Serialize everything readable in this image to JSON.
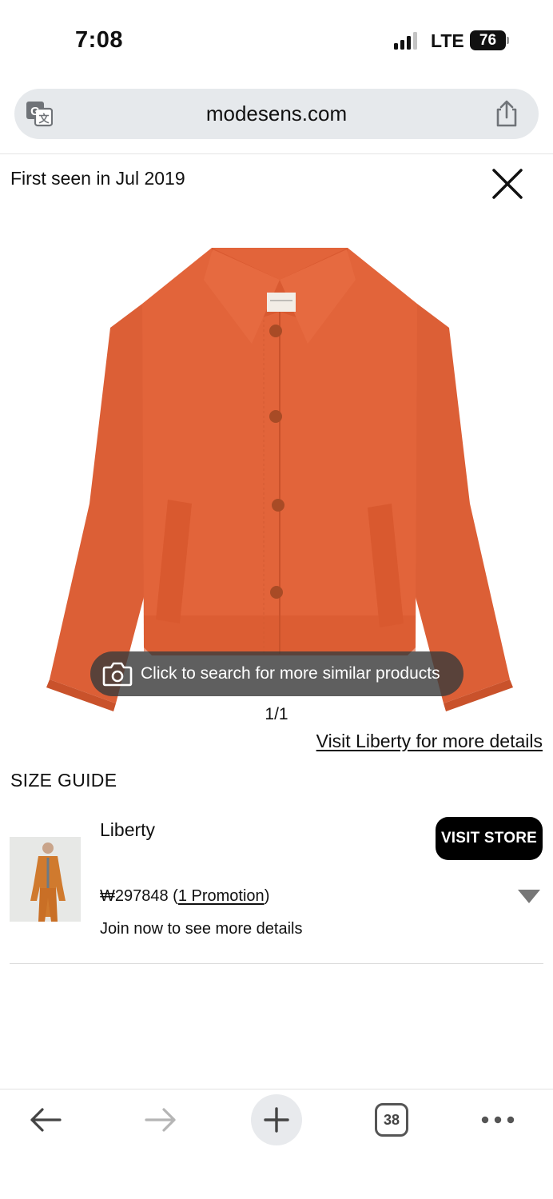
{
  "status_bar": {
    "time": "7:08",
    "network": "LTE",
    "battery": "76"
  },
  "browser": {
    "url": "modesens.com",
    "translate_icon": "translate-icon",
    "share_icon": "share-icon"
  },
  "product": {
    "first_seen": "First seen in Jul 2019",
    "image_icon": "orange-chore-jacket",
    "search_similar_label": "Click to search for more similar products",
    "pager": "1/1",
    "visit_link": "Visit Liberty for more details",
    "size_guide": "SIZE GUIDE"
  },
  "store": {
    "name": "Liberty",
    "visit_button": "VISIT STORE",
    "price": "₩297848",
    "promo_open": " (",
    "promo_link": "1 Promotion",
    "promo_close": ")",
    "join_text": "Join now to see more details"
  },
  "toolbar": {
    "tabs_count": "38"
  },
  "colors": {
    "jacket": "#e2643a",
    "url_bar_bg": "#e6e9ec",
    "visit_store_bg": "#000000",
    "overlay_bg": "#3c3c3c"
  }
}
